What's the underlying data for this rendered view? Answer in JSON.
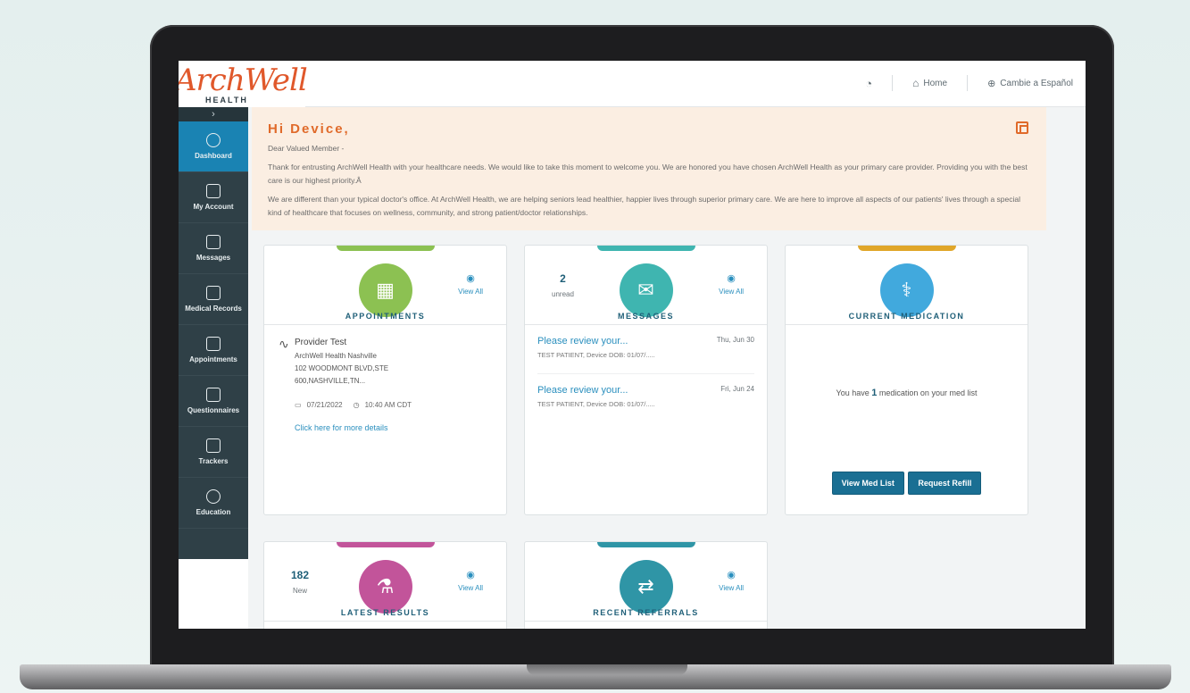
{
  "topbar": {
    "logo_text": "ArchWell",
    "logo_sub": "HEALTH",
    "home_label": "Home",
    "language_label": "Cambie a Español"
  },
  "sidebar": {
    "collapse_glyph": "›",
    "items": [
      {
        "label": "Dashboard",
        "icon": "dashboard-icon",
        "active": true
      },
      {
        "label": "My Account",
        "icon": "account-icon"
      },
      {
        "label": "Messages",
        "icon": "messages-icon"
      },
      {
        "label": "Medical Records",
        "icon": "medical-records-icon"
      },
      {
        "label": "Appointments",
        "icon": "calendar-icon"
      },
      {
        "label": "Questionnaires",
        "icon": "questionnaire-icon"
      },
      {
        "label": "Trackers",
        "icon": "trackers-icon"
      },
      {
        "label": "Education",
        "icon": "education-icon"
      }
    ]
  },
  "welcome": {
    "title": "Hi Device,",
    "greeting": "Dear Valued Member -",
    "paragraph1": "Thank for entrusting ArchWell Health with your healthcare needs. We would like to take this moment to welcome you. We are honored you have chosen ArchWell Health as your primary care provider. Providing you with the best care is our highest priority.Â",
    "paragraph2": "We are different than your typical doctor's office. At ArchWell Health, we are helping seniors lead healthier, happier lives through superior primary care. We are here to improve all aspects of our patients' lives through a special kind of healthcare that focuses on wellness, community, and strong patient/doctor relationships."
  },
  "appointments": {
    "title": "APPOINTMENTS",
    "view_all": "View All",
    "provider": "Provider Test",
    "clinic": "ArchWell Health Nashville",
    "address1": "102 WOODMONT BLVD,STE",
    "address2": "600,NASHVILLE,TN...",
    "date": "07/21/2022",
    "time": "10:40 AM CDT",
    "details_link": "Click here for more details",
    "color": "#8cc152"
  },
  "messages": {
    "title": "MESSAGES",
    "view_all": "View All",
    "unread_count": "2",
    "unread_label": "unread",
    "color": "#3fb5b0",
    "items": [
      {
        "subject": "Please review your...",
        "date": "Thu, Jun 30",
        "from": "TEST PATIENT, Device DOB: 01/07/....."
      },
      {
        "subject": "Please review your...",
        "date": "Fri, Jun 24",
        "from": "TEST PATIENT, Device DOB: 01/07/....."
      }
    ]
  },
  "medication": {
    "title": "CURRENT MEDICATION",
    "text_before": "You have",
    "count": "1",
    "text_after": "medication on your med list",
    "view_btn": "View Med List",
    "refill_btn": "Request Refill",
    "color": "#41a9dd"
  },
  "results": {
    "title": "LATEST RESULTS",
    "view_all": "View All",
    "count": "182",
    "count_label": "New",
    "color": "#c2549a"
  },
  "referrals": {
    "title": "RECENT REFERRALS",
    "view_all": "View All",
    "color": "#2f95a6"
  }
}
